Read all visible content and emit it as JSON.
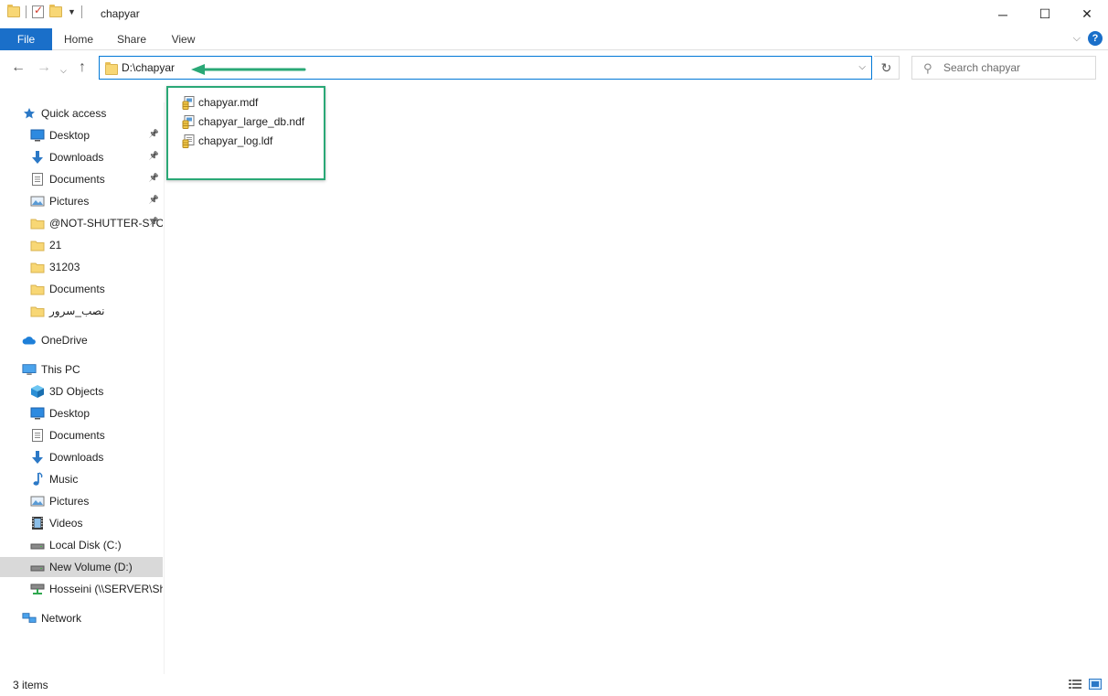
{
  "window": {
    "title": "chapyar",
    "minimize_glyph": "─",
    "maximize_glyph": "☐",
    "close_glyph": "✕"
  },
  "quick_access_toolbar": {
    "icons": [
      "folder-icon",
      "properties-icon",
      "new-folder-icon",
      "customize-dropdown-icon"
    ]
  },
  "ribbon": {
    "tabs": [
      {
        "label": "File",
        "active": true
      },
      {
        "label": "Home"
      },
      {
        "label": "Share"
      },
      {
        "label": "View"
      }
    ],
    "help_glyph": "?"
  },
  "navigation": {
    "address": "D:\\chapyar",
    "search_placeholder": "Search chapyar"
  },
  "sidebar": {
    "items": [
      {
        "label": "Quick access",
        "icon": "star-icon",
        "level": 0
      },
      {
        "label": "Desktop",
        "icon": "desktop-icon",
        "level": 1,
        "pinned": true
      },
      {
        "label": "Downloads",
        "icon": "download-icon",
        "level": 1,
        "pinned": true
      },
      {
        "label": "Documents",
        "icon": "documents-icon",
        "level": 1,
        "pinned": true
      },
      {
        "label": "Pictures",
        "icon": "pictures-icon",
        "level": 1,
        "pinned": true
      },
      {
        "label": "@NOT-SHUTTER-STO",
        "icon": "folder-icon",
        "level": 1,
        "pinned": true
      },
      {
        "label": "21",
        "icon": "folder-icon",
        "level": 1
      },
      {
        "label": "31203",
        "icon": "folder-icon",
        "level": 1
      },
      {
        "label": "Documents",
        "icon": "folder-icon",
        "level": 1
      },
      {
        "label": "نصب_سرور",
        "icon": "folder-icon",
        "level": 1
      },
      {
        "label": "OneDrive",
        "icon": "cloud-icon",
        "level": 0
      },
      {
        "label": "This PC",
        "icon": "computer-icon",
        "level": 0
      },
      {
        "label": "3D Objects",
        "icon": "cube-icon",
        "level": 1
      },
      {
        "label": "Desktop",
        "icon": "desktop-icon",
        "level": 1
      },
      {
        "label": "Documents",
        "icon": "documents-icon",
        "level": 1
      },
      {
        "label": "Downloads",
        "icon": "download-icon",
        "level": 1
      },
      {
        "label": "Music",
        "icon": "music-icon",
        "level": 1
      },
      {
        "label": "Pictures",
        "icon": "pictures-icon",
        "level": 1
      },
      {
        "label": "Videos",
        "icon": "video-icon",
        "level": 1
      },
      {
        "label": "Local Disk (C:)",
        "icon": "drive-icon",
        "level": 1
      },
      {
        "label": "New Volume (D:)",
        "icon": "drive-icon",
        "level": 1,
        "selected": true
      },
      {
        "label": "Hosseini (\\\\SERVER\\Sha",
        "icon": "network-drive-icon",
        "level": 1
      },
      {
        "label": "Network",
        "icon": "network-icon",
        "level": 0
      }
    ]
  },
  "files": [
    {
      "name": "chapyar.mdf",
      "icon": "database-file-icon"
    },
    {
      "name": "chapyar_large_db.ndf",
      "icon": "database-file-icon"
    },
    {
      "name": "chapyar_log.ldf",
      "icon": "database-log-icon"
    }
  ],
  "status": {
    "item_count": "3 items"
  },
  "colors": {
    "accent": "#1a6fc9",
    "highlight_border": "#2aa876",
    "arrow": "#2aa876",
    "address_border": "#0078d7",
    "selected_bg": "#d9d9d9"
  }
}
